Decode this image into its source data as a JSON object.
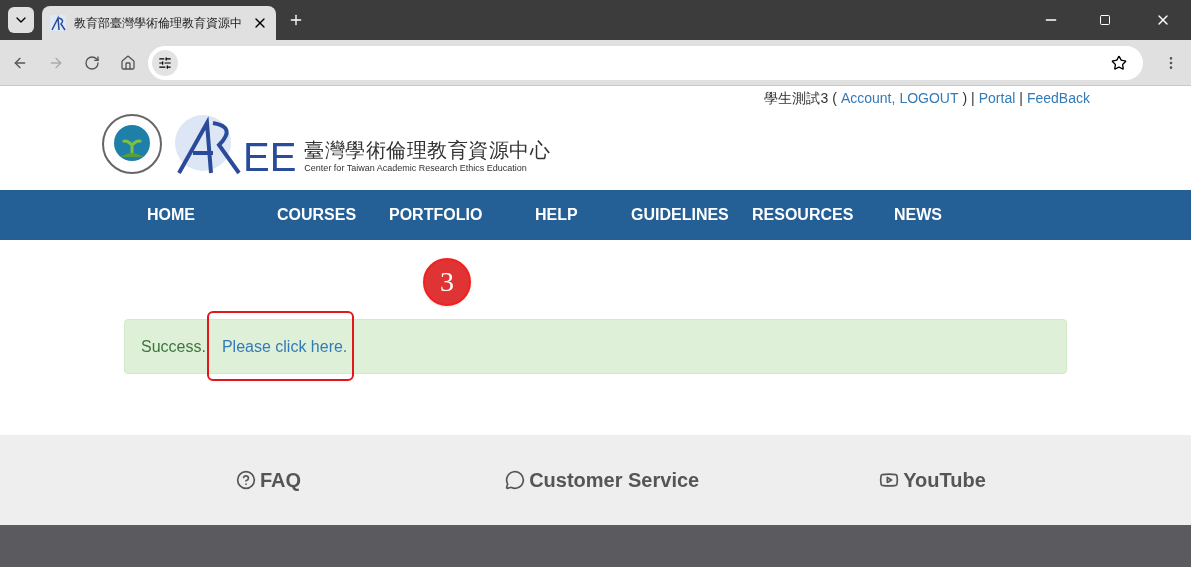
{
  "browser": {
    "tab_title": "教育部臺灣學術倫理教育資源中"
  },
  "header": {
    "user": "學生測試3",
    "open_paren": "(",
    "account": "Account,",
    "logout": "LOGOUT",
    "close_sep": ") |",
    "sep": "|",
    "portal": "Portal",
    "feedback": "FeedBack",
    "logo_letters": "EE",
    "logo_title": "臺灣學術倫理教育資源中心",
    "logo_subtitle": "Center for Taiwan Academic Research Ethics Education"
  },
  "nav": [
    "HOME",
    "COURSES",
    "PORTFOLIO",
    "HELP",
    "GUIDELINES",
    "RESOURCES",
    "NEWS"
  ],
  "alert": {
    "message": "Success.",
    "link": "Please click here."
  },
  "annotation": {
    "number": "3"
  },
  "footer": [
    {
      "kind": "faq",
      "label": "FAQ"
    },
    {
      "kind": "service",
      "label": "Customer Service"
    },
    {
      "kind": "youtube",
      "label": "YouTube"
    }
  ]
}
